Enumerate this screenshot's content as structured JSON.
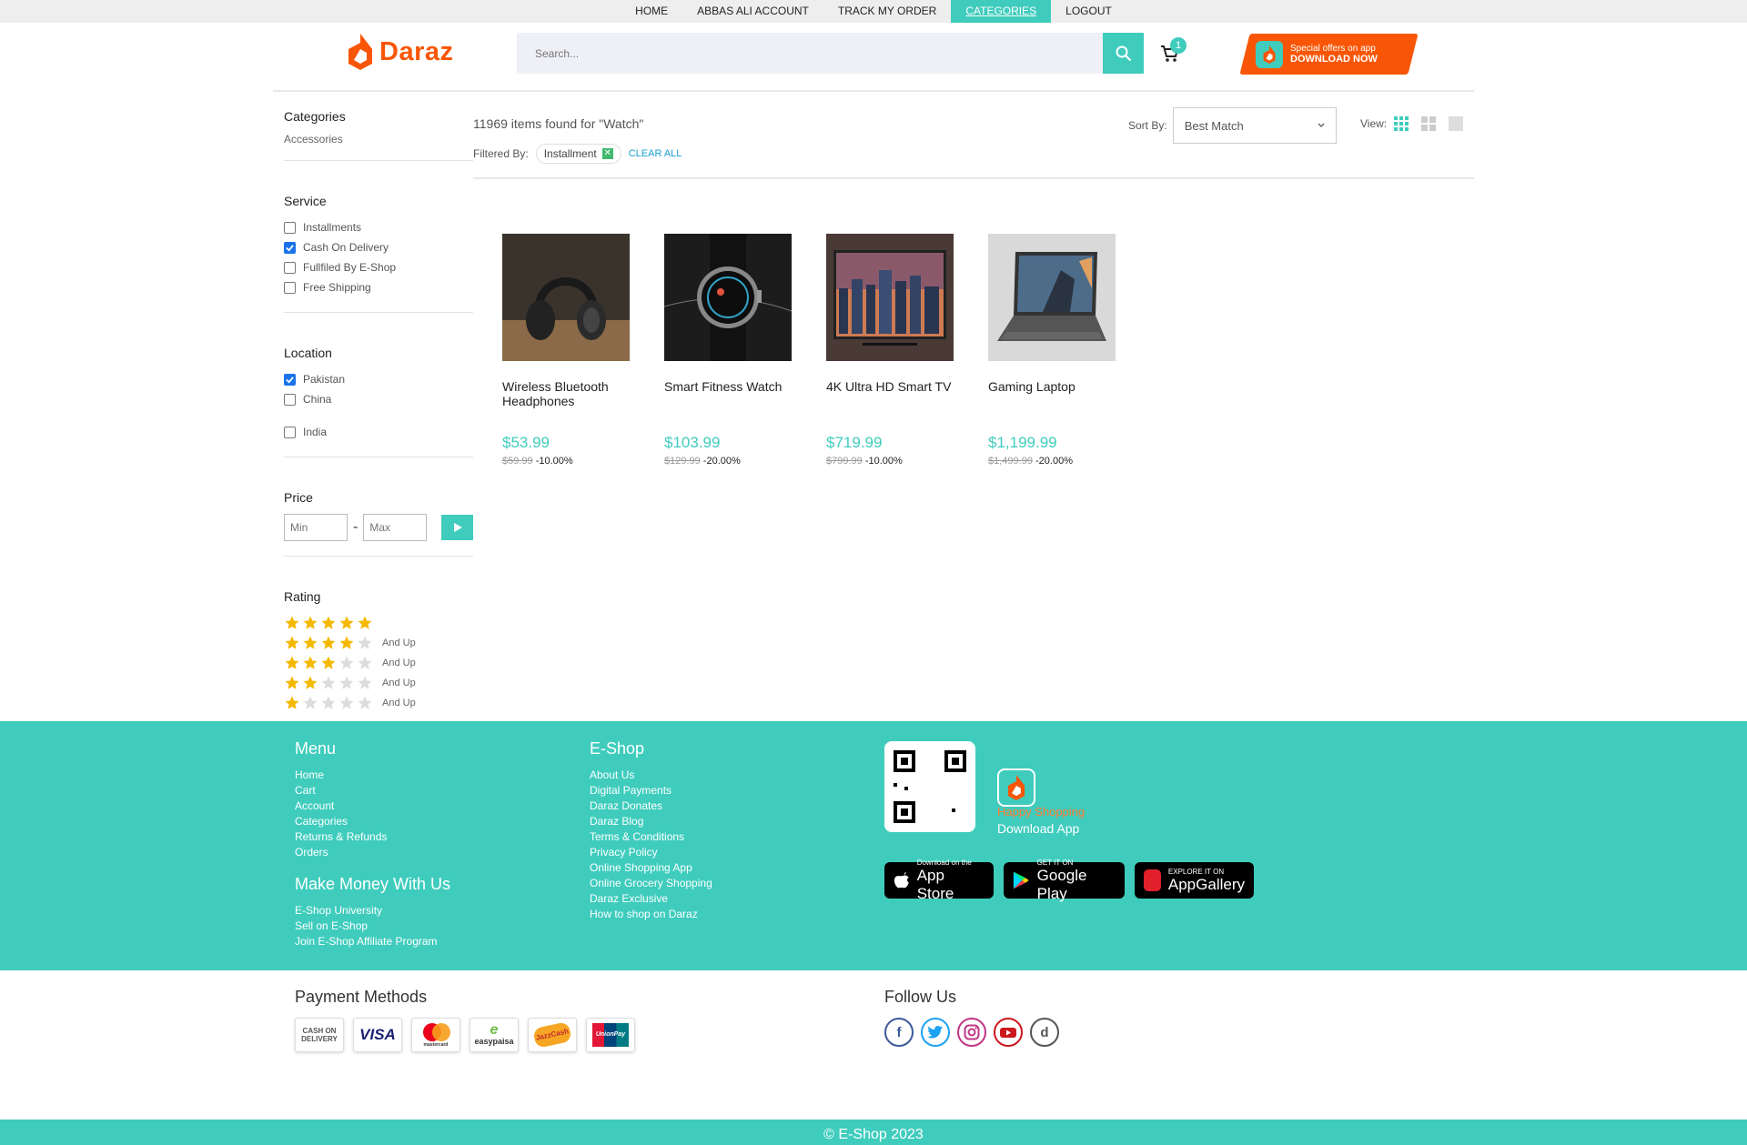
{
  "topnav": {
    "items": [
      {
        "label": "HOME"
      },
      {
        "label": "ABBAS ALI ACCOUNT"
      },
      {
        "label": "TRACK MY ORDER"
      },
      {
        "label": "CATEGORIES"
      },
      {
        "label": "LOGOUT"
      }
    ],
    "active_index": 3
  },
  "header": {
    "logo_text": "Daraz",
    "search_placeholder": "Search...",
    "cart_count": "1",
    "promo_line1": "Special offers on app",
    "promo_line2": "DOWNLOAD NOW"
  },
  "sidebar": {
    "categories": {
      "title": "Categories",
      "link": "Accessories"
    },
    "service": {
      "title": "Service",
      "options": [
        {
          "label": "Installments",
          "checked": false
        },
        {
          "label": "Cash On Delivery",
          "checked": true
        },
        {
          "label": "Fullfiled By E-Shop",
          "checked": false
        },
        {
          "label": "Free Shipping",
          "checked": false
        }
      ]
    },
    "location": {
      "title": "Location",
      "options": [
        {
          "label": "Pakistan",
          "checked": true
        },
        {
          "label": "China",
          "checked": false
        },
        {
          "label": "India",
          "checked": false
        }
      ]
    },
    "price": {
      "title": "Price",
      "min_placeholder": "Min",
      "max_placeholder": "Max",
      "separator": "-"
    },
    "rating": {
      "title": "Rating",
      "rows": [
        {
          "stars": 5,
          "suffix": ""
        },
        {
          "stars": 4,
          "suffix": "And Up"
        },
        {
          "stars": 3,
          "suffix": "And Up"
        },
        {
          "stars": 2,
          "suffix": "And Up"
        },
        {
          "stars": 1,
          "suffix": "And Up"
        }
      ]
    }
  },
  "main": {
    "results_text": "11969 items found for \"Watch\"",
    "filtered_by_label": "Filtered By:",
    "filter_chip": "Installment",
    "clear_all": "CLEAR ALL",
    "sort_label": "Sort By:",
    "sort_value": "Best Match",
    "view_label": "View:",
    "products": [
      {
        "name": "Wireless Bluetooth Headphones",
        "price": "$53.99",
        "old_price": "$59.99",
        "discount": "-10.00%",
        "image": "headphones"
      },
      {
        "name": "Smart Fitness Watch",
        "price": "$103.99",
        "old_price": "$129.99",
        "discount": "-20.00%",
        "image": "smartwatch"
      },
      {
        "name": "4K Ultra HD Smart TV",
        "price": "$719.99",
        "old_price": "$799.99",
        "discount": "-10.00%",
        "image": "tv"
      },
      {
        "name": "Gaming Laptop",
        "price": "$1,199.99",
        "old_price": "$1,499.99",
        "discount": "-20.00%",
        "image": "laptop"
      }
    ]
  },
  "footer": {
    "menu_title": "Menu",
    "menu_links": [
      "Home",
      "Cart",
      "Account",
      "Categories",
      "Returns & Refunds",
      "Orders"
    ],
    "money_title": "Make Money With Us",
    "money_links": [
      "E-Shop University",
      "Sell on E-Shop",
      "Join E-Shop Affiliate Program"
    ],
    "eshop_title": "E-Shop",
    "eshop_links": [
      "About Us",
      "Digital Payments",
      "Daraz Donates",
      "Daraz Blog",
      "Terms & Conditions",
      "Privacy Policy",
      "Online Shopping App",
      "Online Grocery Shopping",
      "Daraz Exclusive",
      "How to shop on Daraz"
    ],
    "happy_text": "Happy Shopping",
    "download_text": "Download App",
    "stores": [
      {
        "small": "Download on the",
        "big": "App Store"
      },
      {
        "small": "GET IT ON",
        "big": "Google Play"
      },
      {
        "small": "EXPLORE IT ON",
        "big": "AppGallery"
      }
    ]
  },
  "payments": {
    "title": "Payment Methods",
    "methods": [
      "CASH ON DELIVERY",
      "VISA",
      "mastercard",
      "easypaisa",
      "JazzCash",
      "UnionPay"
    ]
  },
  "follow": {
    "title": "Follow Us",
    "networks": [
      "facebook",
      "twitter",
      "instagram",
      "youtube",
      "daraz"
    ]
  },
  "copyright": "© E-Shop 2023",
  "colors": {
    "accent": "#3fccbd",
    "brand": "#f85606",
    "star": "#f5b800",
    "star_empty": "#dddddd"
  }
}
